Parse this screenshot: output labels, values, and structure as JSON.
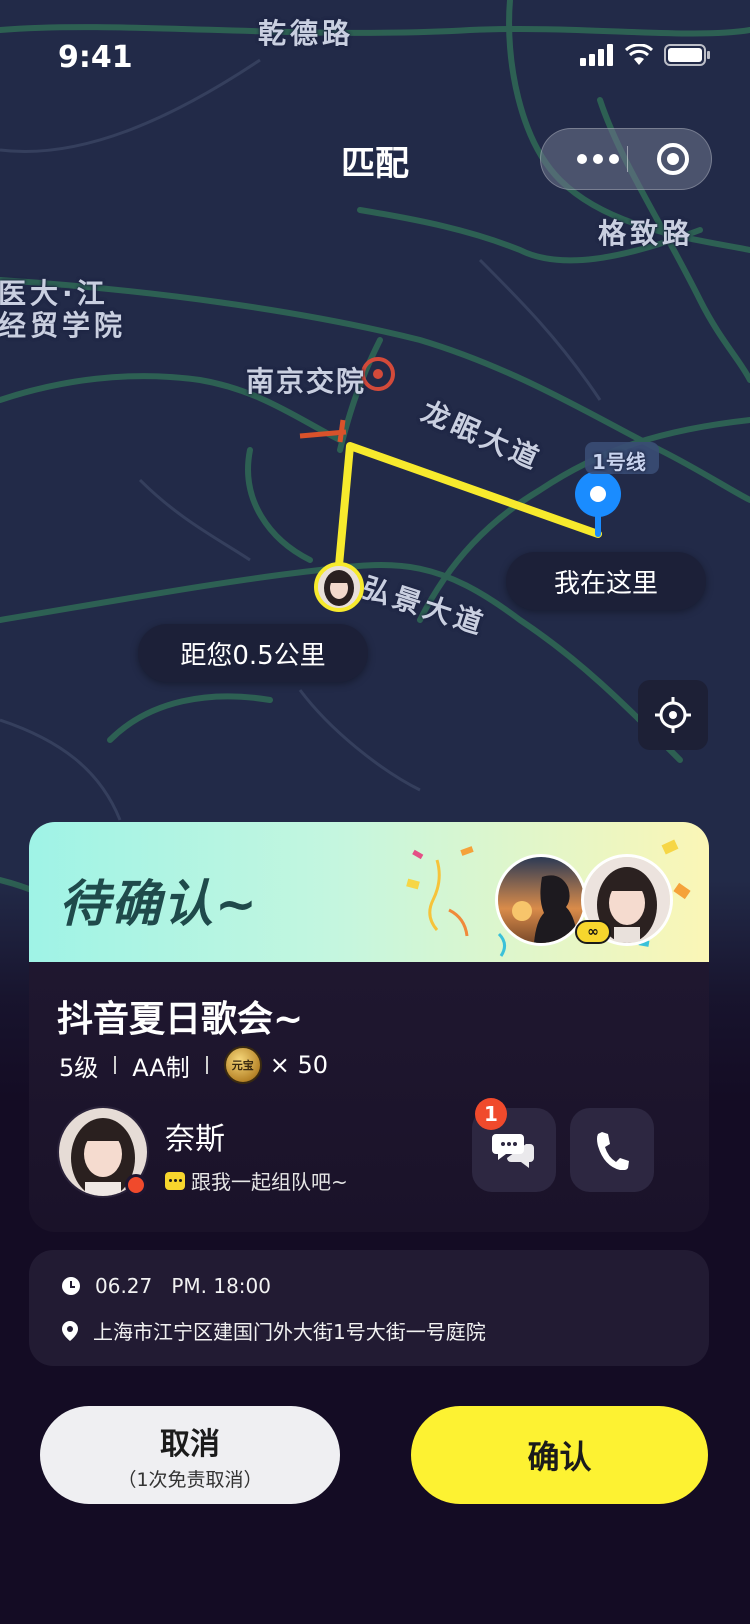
{
  "status_bar": {
    "time": "9:41"
  },
  "nav": {
    "title": "匹配"
  },
  "map": {
    "labels": {
      "qiande_road": "乾德路",
      "gezhi_road": "格致路",
      "college_line1": "医大·江",
      "college_line2": "经贸学院",
      "nanjing_jiaoyuan": "南京交院",
      "longmian_avenue": "龙眠大道",
      "hongjing_avenue": "弘景大道",
      "metro_line": "1号线"
    },
    "distance_bubble": "距您0.5公里",
    "my_location_bubble": "我在这里"
  },
  "match_card": {
    "status_title": "待确认~",
    "event_title": "抖音夏日歌会~",
    "level": "5级",
    "payment": "AA制",
    "coin_label": "元宝",
    "coin_amount": "× 50",
    "user": {
      "name": "奈斯",
      "message": "跟我一起组队吧~"
    },
    "chat_unread": "1"
  },
  "info": {
    "datetime": "06.27   PM. 18:00",
    "address": "上海市江宁区建国门外大街1号大街一号庭院"
  },
  "actions": {
    "cancel_label": "取消",
    "cancel_sub": "（1次免责取消）",
    "confirm_label": "确认"
  },
  "colors": {
    "route": "#f7ea2d",
    "my_pin": "#1a8cff",
    "confirm_button": "#fdf232",
    "header_gradient_start": "#9ff3e6",
    "header_gradient_end": "#fbf6b6",
    "unread_badge": "#f04a2c"
  },
  "icons": [
    "signal-icon",
    "wifi-icon",
    "battery-icon",
    "more-icon",
    "target-icon",
    "locate-icon",
    "location-pin-icon",
    "chat-icon",
    "phone-icon",
    "clock-icon",
    "map-pin-icon",
    "link-icon",
    "coin-icon",
    "message-bubble-icon"
  ]
}
